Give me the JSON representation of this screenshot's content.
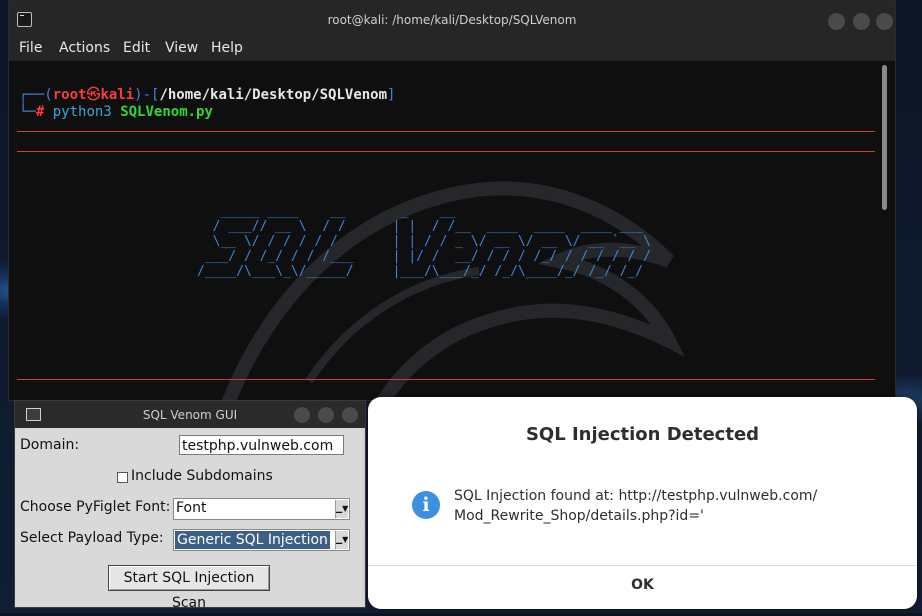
{
  "terminal": {
    "title": "root@kali: /home/kali/Desktop/SQLVenom",
    "menu": [
      "File",
      "Actions",
      "Edit",
      "View",
      "Help"
    ],
    "prompt": {
      "open": "┌──(",
      "user": "root",
      "skull": "㉿",
      "host": "kali",
      "mid": ")-[",
      "path": "/home/kali/Desktop/SQLVenom",
      "close": "]",
      "corner": "└─",
      "hash": "#",
      "command": "python3",
      "arg": "SQLVenom.py"
    },
    "banner": [
      "   _____ ____    __       _    __",
      "  / ___// __ \\  / /      | |  / /__  ____  ____  ____ ___",
      "  \\__ \\/ / / / / /       | | / / _ \\/ __ \\/ __ \\/ __ `__ \\",
      " ___/ / /_/ / / /___     | |/ /  __/ / / / /_/ / / / / / /",
      "/____/\\___\\_\\/_____/     |___/\\___/_/ /_/\\____/_/ /_/ /_/"
    ]
  },
  "gui": {
    "title": "SQL Venom GUI",
    "domain_label": "Domain:",
    "domain_value": "testphp.vulnweb.com",
    "subdomains_label": "Include Subdomains",
    "font_label": "Choose PyFiglet Font:",
    "font_value": "Font",
    "payload_label": "Select Payload Type:",
    "payload_value": "Generic SQL Injection",
    "scan_button": "Start SQL Injection Scan"
  },
  "dialog": {
    "title": "SQL Injection Detected",
    "message_line1": "SQL Injection found at: http://testphp.vulnweb.com/",
    "message_line2": "Mod_Rewrite_Shop/details.php?id='",
    "ok": "OK",
    "icon": "i"
  },
  "colors": {
    "prompt_blue": "#4a7fd6",
    "prompt_red": "#ff3b3b",
    "prompt_green": "#33d633",
    "banner_blue": "#3d84d8",
    "rule_red": "#d23a3a",
    "info_blue": "#3d8fe0"
  }
}
